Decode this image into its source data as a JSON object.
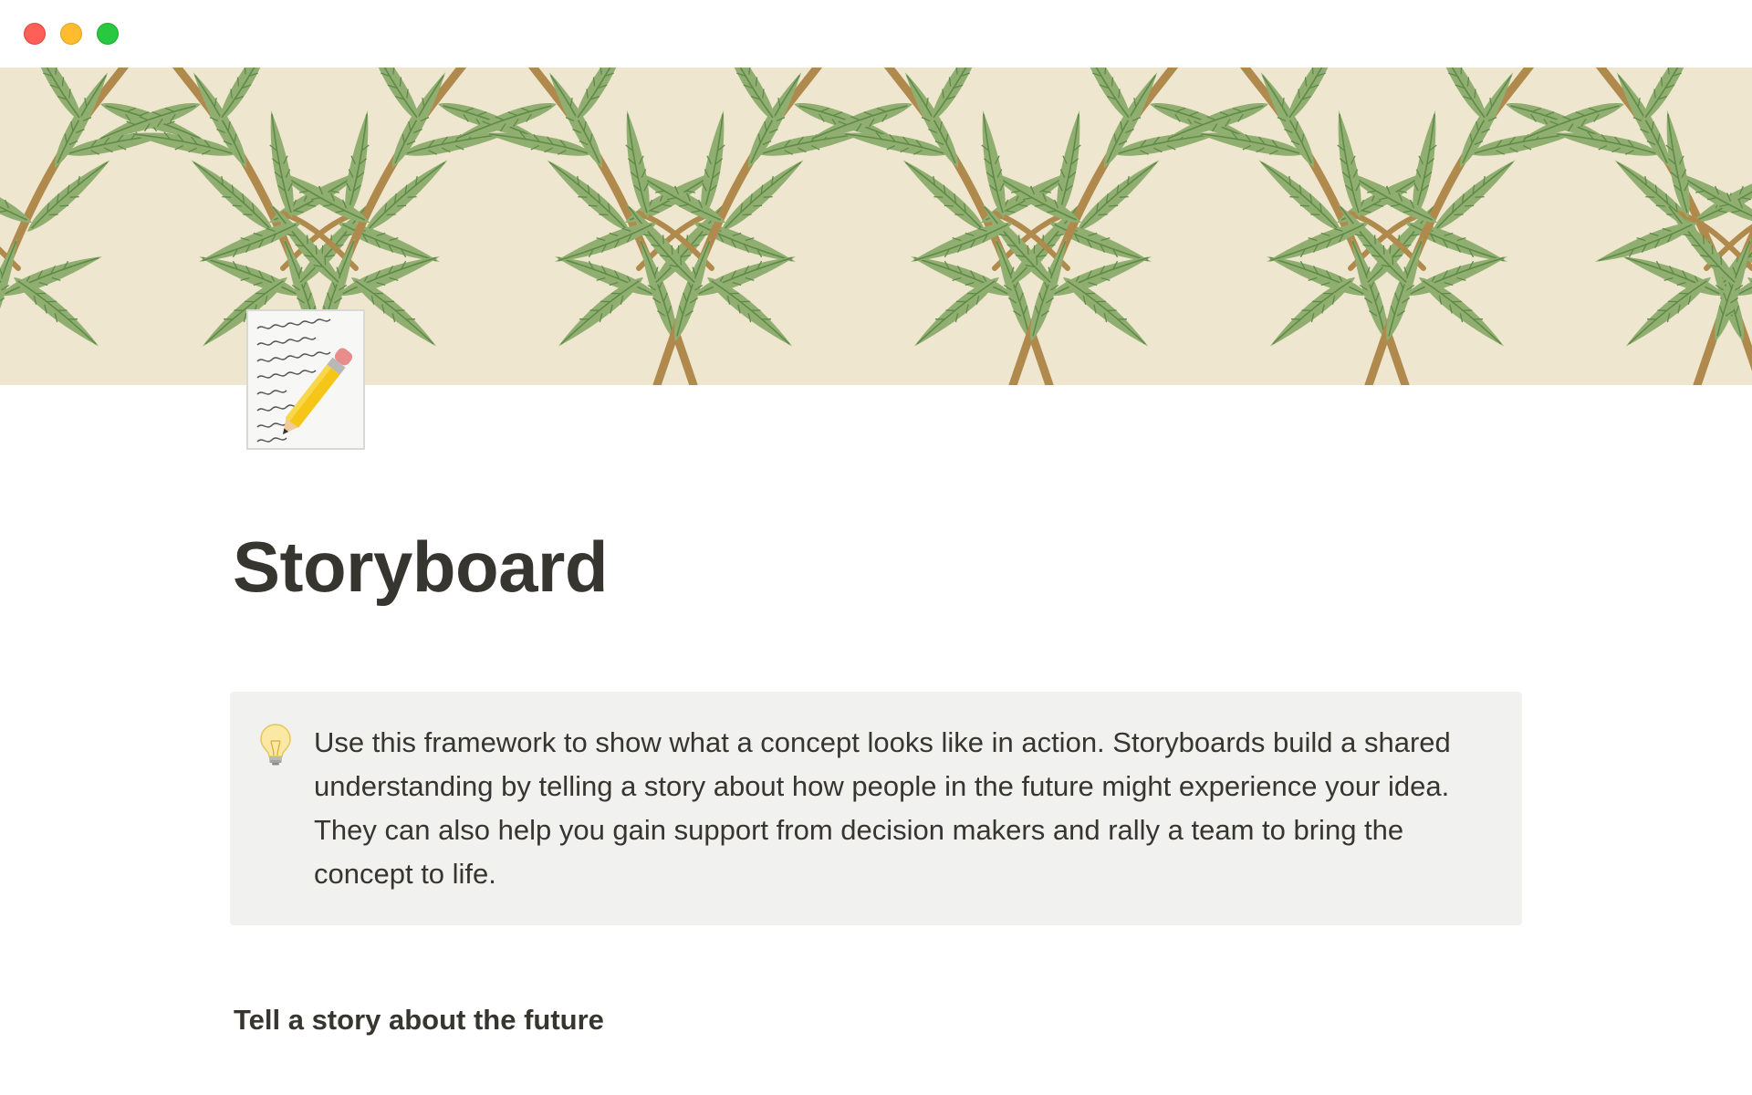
{
  "window": {
    "controls": [
      "close",
      "minimize",
      "zoom"
    ],
    "colors": {
      "close": "#fe5f57",
      "minimize": "#febc2e",
      "zoom": "#28c840"
    }
  },
  "page": {
    "icon": "memo-icon",
    "title": "Storyboard"
  },
  "callout": {
    "icon": "light-bulb-icon",
    "text": "Use this framework to show what a concept looks like in action. Storyboards build a shared understanding by telling a story about how people in the future might experience your idea. They can also help you gain support from decision makers and rally a team to bring the concept to life."
  },
  "sections": [
    {
      "heading": "Tell a story about the future"
    }
  ],
  "colors": {
    "text": "#37352f",
    "callout_bg": "#f1f1ef",
    "cover_bg": "#efe6cf",
    "leaf": "#8fae70",
    "stem": "#b08a4c"
  }
}
